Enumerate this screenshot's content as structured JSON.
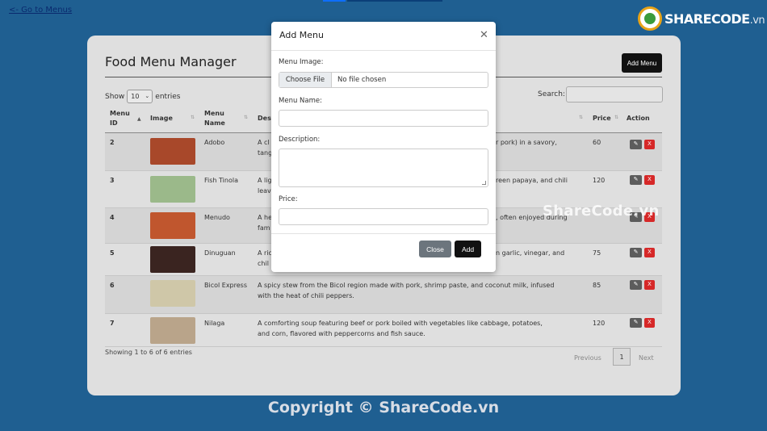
{
  "nav": {
    "back_link": "<- Go to Menus"
  },
  "logo": {
    "brand": "SHARECODE",
    "domain": ".vn"
  },
  "card": {
    "title": "Food Menu Manager",
    "add_button": "Add Menu",
    "show_label": "Show",
    "entries_value": "10",
    "entries_label": "entries",
    "search_label": "Search:",
    "columns": {
      "id": "Menu ID",
      "image": "Image",
      "name": "Menu Name",
      "description": "Des",
      "price": "Price",
      "action": "Action"
    },
    "rows": [
      {
        "id": "2",
        "name": "Adobo",
        "description_line1": "A cl",
        "description_tail1": "r pork) in a savory,",
        "description_line2": "tang",
        "price": "60",
        "thumb": "#a8482a"
      },
      {
        "id": "3",
        "name": "Fish Tinola",
        "description_line1": "A lig",
        "description_tail1": "reen papaya, and chili",
        "description_line2": "leav",
        "price": "120",
        "thumb": "#9bb98a"
      },
      {
        "id": "4",
        "name": "Menudo",
        "description_line1": "A he",
        "description_tail1": ", often enjoyed during",
        "description_line2": "fam",
        "price": "",
        "thumb": "#c0562e"
      },
      {
        "id": "5",
        "name": "Dinuguan",
        "description_line1": "A ric",
        "description_tail1": "n garlic, vinegar, and",
        "description_line2": "chil",
        "price": "75",
        "thumb": "#3a2420"
      },
      {
        "id": "6",
        "name": "Bicol Express",
        "description_line1": "A spicy stew from the Bicol region made with pork, shrimp paste, and coconut milk, infused",
        "description_tail1": "",
        "description_line2": "with the heat of chili peppers.",
        "price": "85",
        "thumb": "#cfc7a8"
      },
      {
        "id": "7",
        "name": "Nilaga",
        "description_line1": "A comforting soup featuring beef or pork boiled with vegetables like cabbage, potatoes,",
        "description_tail1": "",
        "description_line2": "and corn, flavored with peppercorns and fish sauce.",
        "price": "120",
        "thumb": "#b9a48a"
      }
    ],
    "footer_info": "Showing 1 to 6 of 6 entries",
    "pager": {
      "previous": "Previous",
      "page": "1",
      "next": "Next"
    }
  },
  "modal": {
    "title": "Add Menu",
    "image_label": "Menu Image:",
    "file_button": "Choose File",
    "file_name": "No file chosen",
    "name_label": "Menu Name:",
    "description_label": "Description:",
    "price_label": "Price:",
    "close_button": "Close",
    "add_button": "Add"
  },
  "watermark": {
    "middle": "ShareCode.vn",
    "copyright": "Copyright © ShareCode.vn"
  },
  "colors": {
    "background": "#1f5f91",
    "card": "#dfdfdf",
    "delete": "#d62828",
    "edit": "#5c5c5c"
  }
}
